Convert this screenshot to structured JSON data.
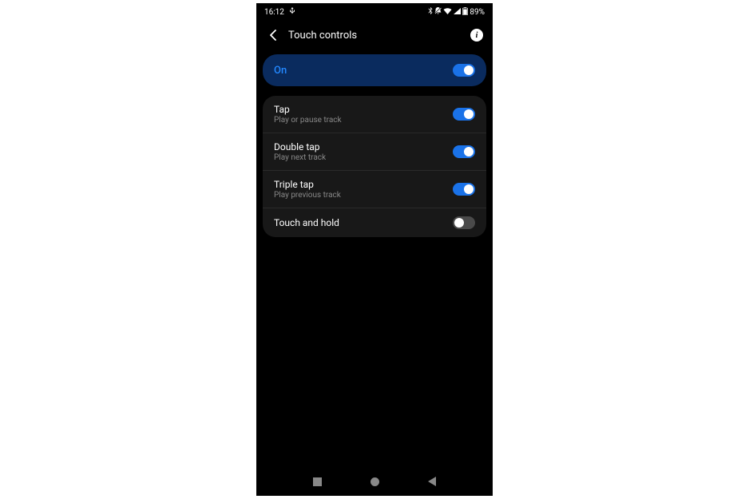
{
  "statusBar": {
    "time": "16:12",
    "battery": "89%"
  },
  "header": {
    "title": "Touch controls"
  },
  "masterToggle": {
    "label": "On",
    "enabled": true
  },
  "settings": [
    {
      "title": "Tap",
      "description": "Play or pause track",
      "enabled": true
    },
    {
      "title": "Double tap",
      "description": "Play next track",
      "enabled": true
    },
    {
      "title": "Triple tap",
      "description": "Play previous track",
      "enabled": true
    },
    {
      "title": "Touch and hold",
      "description": "",
      "enabled": false
    }
  ]
}
